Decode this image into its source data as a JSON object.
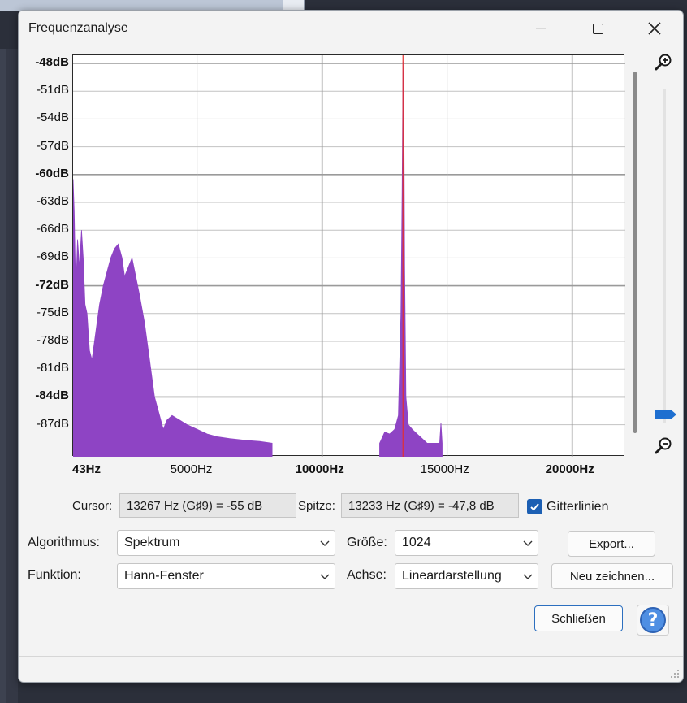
{
  "window": {
    "title": "Frequenzanalyse"
  },
  "plot": {
    "y_ticks": [
      {
        "label": "-48dB",
        "bold": true
      },
      {
        "label": "-51dB",
        "bold": false
      },
      {
        "label": "-54dB",
        "bold": false
      },
      {
        "label": "-57dB",
        "bold": false
      },
      {
        "label": "-60dB",
        "bold": true
      },
      {
        "label": "-63dB",
        "bold": false
      },
      {
        "label": "-66dB",
        "bold": false
      },
      {
        "label": "-69dB",
        "bold": false
      },
      {
        "label": "-72dB",
        "bold": true
      },
      {
        "label": "-75dB",
        "bold": false
      },
      {
        "label": "-78dB",
        "bold": false
      },
      {
        "label": "-81dB",
        "bold": false
      },
      {
        "label": "-84dB",
        "bold": true
      },
      {
        "label": "-87dB",
        "bold": false
      }
    ],
    "x_ticks": [
      {
        "label": "43Hz",
        "value": 43,
        "bold": true
      },
      {
        "label": "5000Hz",
        "value": 5000,
        "bold": false
      },
      {
        "label": "10000Hz",
        "value": 10000,
        "bold": true
      },
      {
        "label": "15000Hz",
        "value": 15000,
        "bold": false
      },
      {
        "label": "20000Hz",
        "value": 20000,
        "bold": true
      }
    ]
  },
  "chart_data": {
    "type": "area",
    "x_unit": "Hz",
    "y_unit": "dB",
    "xlim": [
      43,
      22050
    ],
    "ylim": [
      -89,
      -48
    ],
    "grid": true,
    "colors": {
      "spectrum": "#8e44c4",
      "cursor_line": "#e23030",
      "grid": "#b0b0b0"
    },
    "cursor_frequency": 13233,
    "spectrum": [
      [
        43,
        -60.5
      ],
      [
        90,
        -64
      ],
      [
        150,
        -73
      ],
      [
        220,
        -67
      ],
      [
        300,
        -70
      ],
      [
        380,
        -66
      ],
      [
        450,
        -69
      ],
      [
        520,
        -74
      ],
      [
        600,
        -75
      ],
      [
        700,
        -79
      ],
      [
        800,
        -80
      ],
      [
        900,
        -78
      ],
      [
        1000,
        -76
      ],
      [
        1100,
        -74
      ],
      [
        1250,
        -72
      ],
      [
        1400,
        -70.5
      ],
      [
        1550,
        -69
      ],
      [
        1700,
        -68
      ],
      [
        1850,
        -67.5
      ],
      [
        2000,
        -69
      ],
      [
        2100,
        -71
      ],
      [
        2250,
        -70
      ],
      [
        2400,
        -69
      ],
      [
        2550,
        -71
      ],
      [
        2700,
        -73
      ],
      [
        2900,
        -76
      ],
      [
        3100,
        -80
      ],
      [
        3300,
        -84
      ],
      [
        3500,
        -86
      ],
      [
        3650,
        -87.5
      ],
      [
        3800,
        -86.5
      ],
      [
        4000,
        -86
      ],
      [
        4300,
        -86.5
      ],
      [
        4600,
        -87
      ],
      [
        5000,
        -87.5
      ],
      [
        5400,
        -88
      ],
      [
        5800,
        -88.3
      ],
      [
        6300,
        -88.5
      ],
      [
        7000,
        -88.7
      ],
      [
        7500,
        -88.8
      ],
      [
        8000,
        -89
      ],
      [
        12300,
        -89
      ],
      [
        12500,
        -87.8
      ],
      [
        12700,
        -88
      ],
      [
        12900,
        -87.5
      ],
      [
        13050,
        -86
      ],
      [
        13150,
        -75
      ],
      [
        13200,
        -62
      ],
      [
        13233,
        -47.8
      ],
      [
        13267,
        -52
      ],
      [
        13300,
        -70
      ],
      [
        13350,
        -84
      ],
      [
        13450,
        -87
      ],
      [
        13600,
        -87.5
      ],
      [
        13800,
        -88
      ],
      [
        14000,
        -88.5
      ],
      [
        14200,
        -89
      ],
      [
        14700,
        -89
      ],
      [
        14750,
        -86.8
      ],
      [
        14800,
        -89
      ]
    ]
  },
  "controls": {
    "cursor_label": "Cursor:",
    "cursor_value": "13267 Hz (G♯9) = -55 dB",
    "peak_label": "Spitze:",
    "peak_value": "13233 Hz (G♯9) = -47,8 dB",
    "grid_label": "Gitterlinien",
    "grid_checked": true,
    "algorithm_label": "Algorithmus:",
    "algorithm_value": "Spektrum",
    "size_label": "Größe:",
    "size_value": "1024",
    "export_button": "Export...",
    "function_label": "Funktion:",
    "function_value": "Hann-Fenster",
    "axis_label": "Achse:",
    "axis_value": "Lineardarstellung",
    "redraw_button": "Neu zeichnen...",
    "close_button": "Schließen",
    "help_button": "?"
  }
}
